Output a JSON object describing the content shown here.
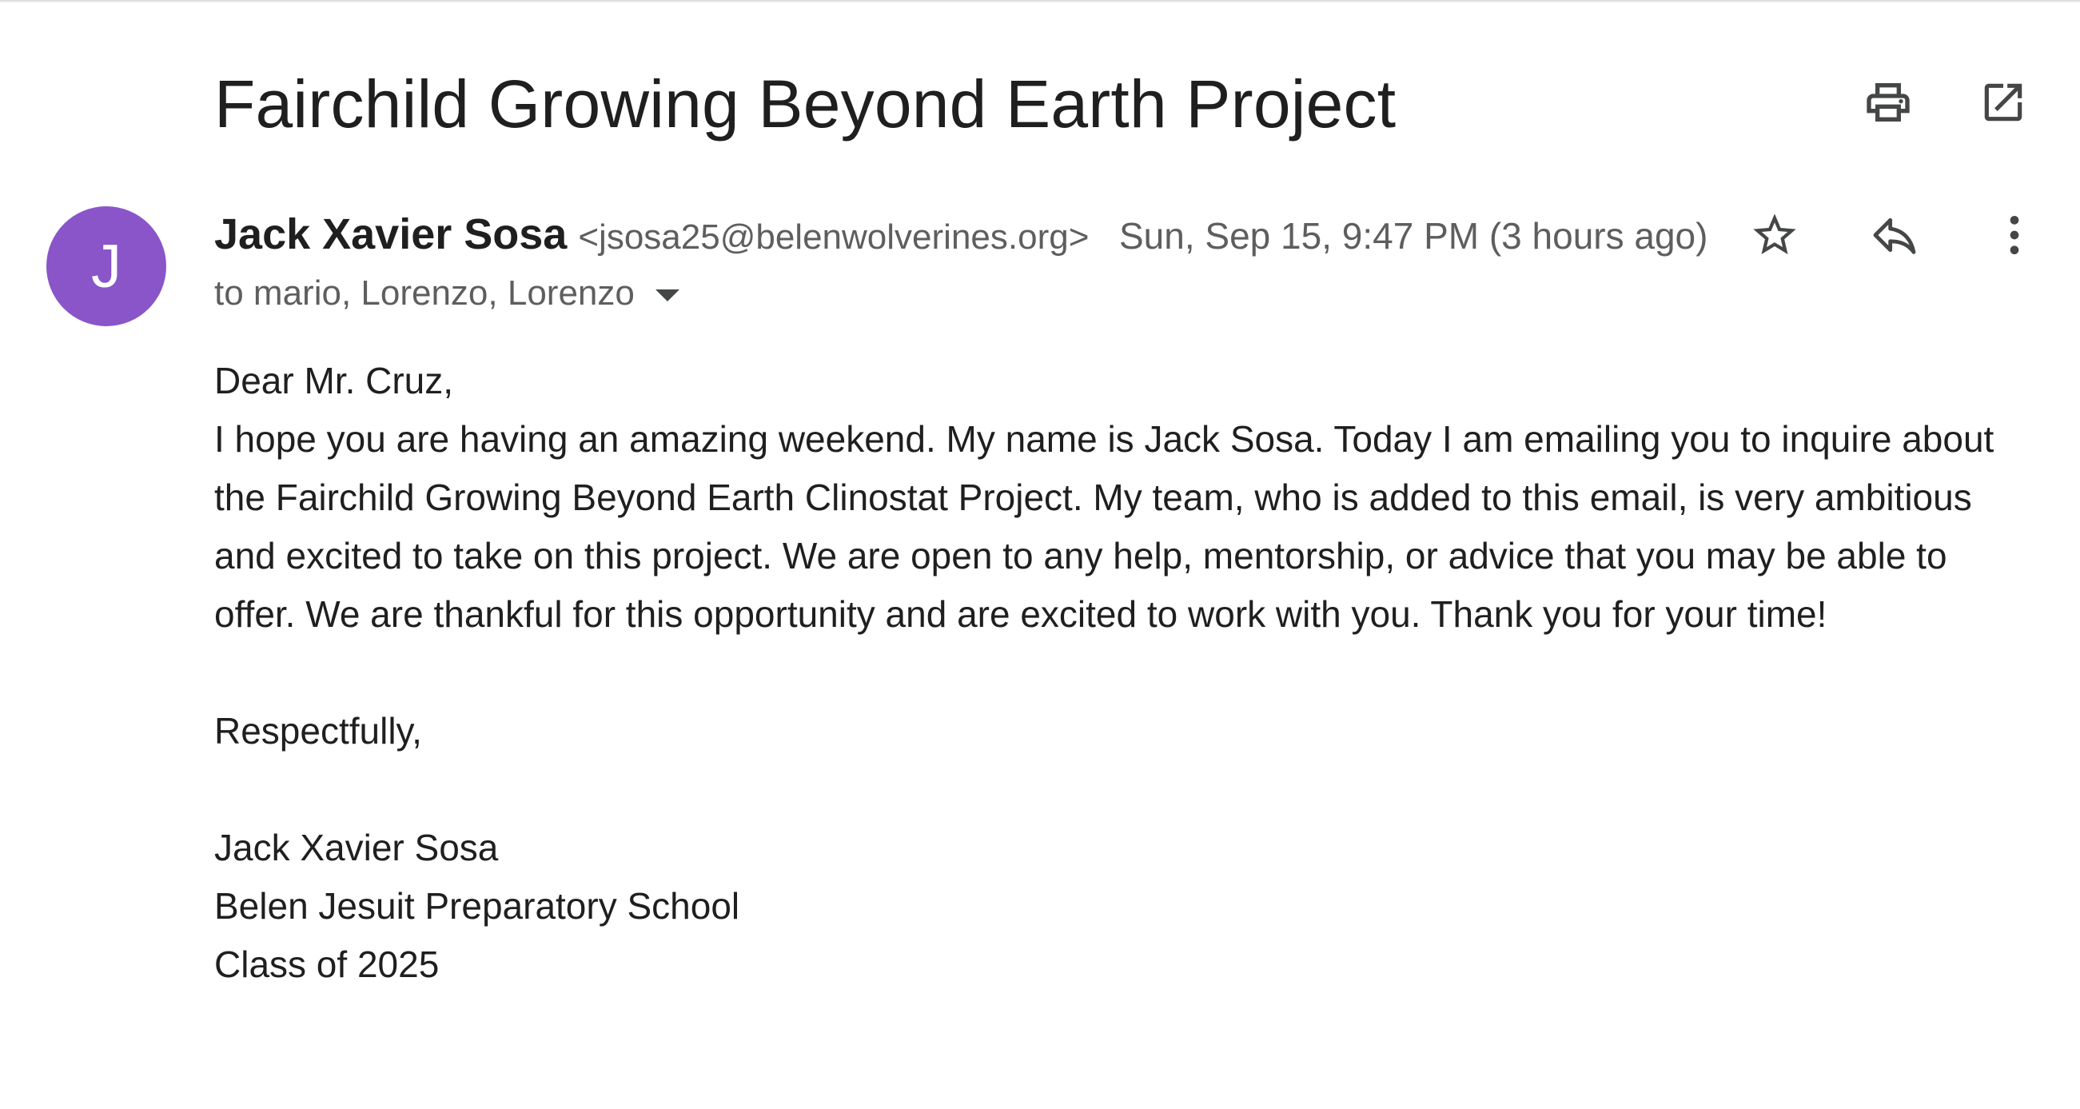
{
  "email": {
    "subject": "Fairchild Growing Beyond Earth Project",
    "avatar_letter": "J",
    "avatar_color": "#8a55c8",
    "sender_name": "Jack Xavier Sosa",
    "sender_email": "<jsosa25@belenwolverines.org>",
    "timestamp": "Sun, Sep 15, 9:47 PM (3 hours ago)",
    "recipients": "to mario, Lorenzo, Lorenzo",
    "body": {
      "greeting": "Dear Mr. Cruz,",
      "paragraph": "I hope you are having an amazing weekend. My name is Jack Sosa. Today I am emailing you to inquire about the Fairchild Growing Beyond Earth Clinostat Project. My team, who is added to this email, is very ambitious and excited to take on this project. We are open to any help, mentorship, or advice that you may be able to offer. We are thankful for this opportunity and are excited to work with you. Thank you for your time!",
      "closing": "Respectfully,",
      "signature_name": "Jack Xavier Sosa",
      "signature_school": "Belen Jesuit Preparatory School",
      "signature_class": "Class of 2025"
    }
  },
  "icons": {
    "print": "print-icon",
    "open_new_window": "open-in-new-window-icon",
    "star": "star-icon",
    "reply": "reply-icon",
    "more": "more-vert-icon"
  }
}
